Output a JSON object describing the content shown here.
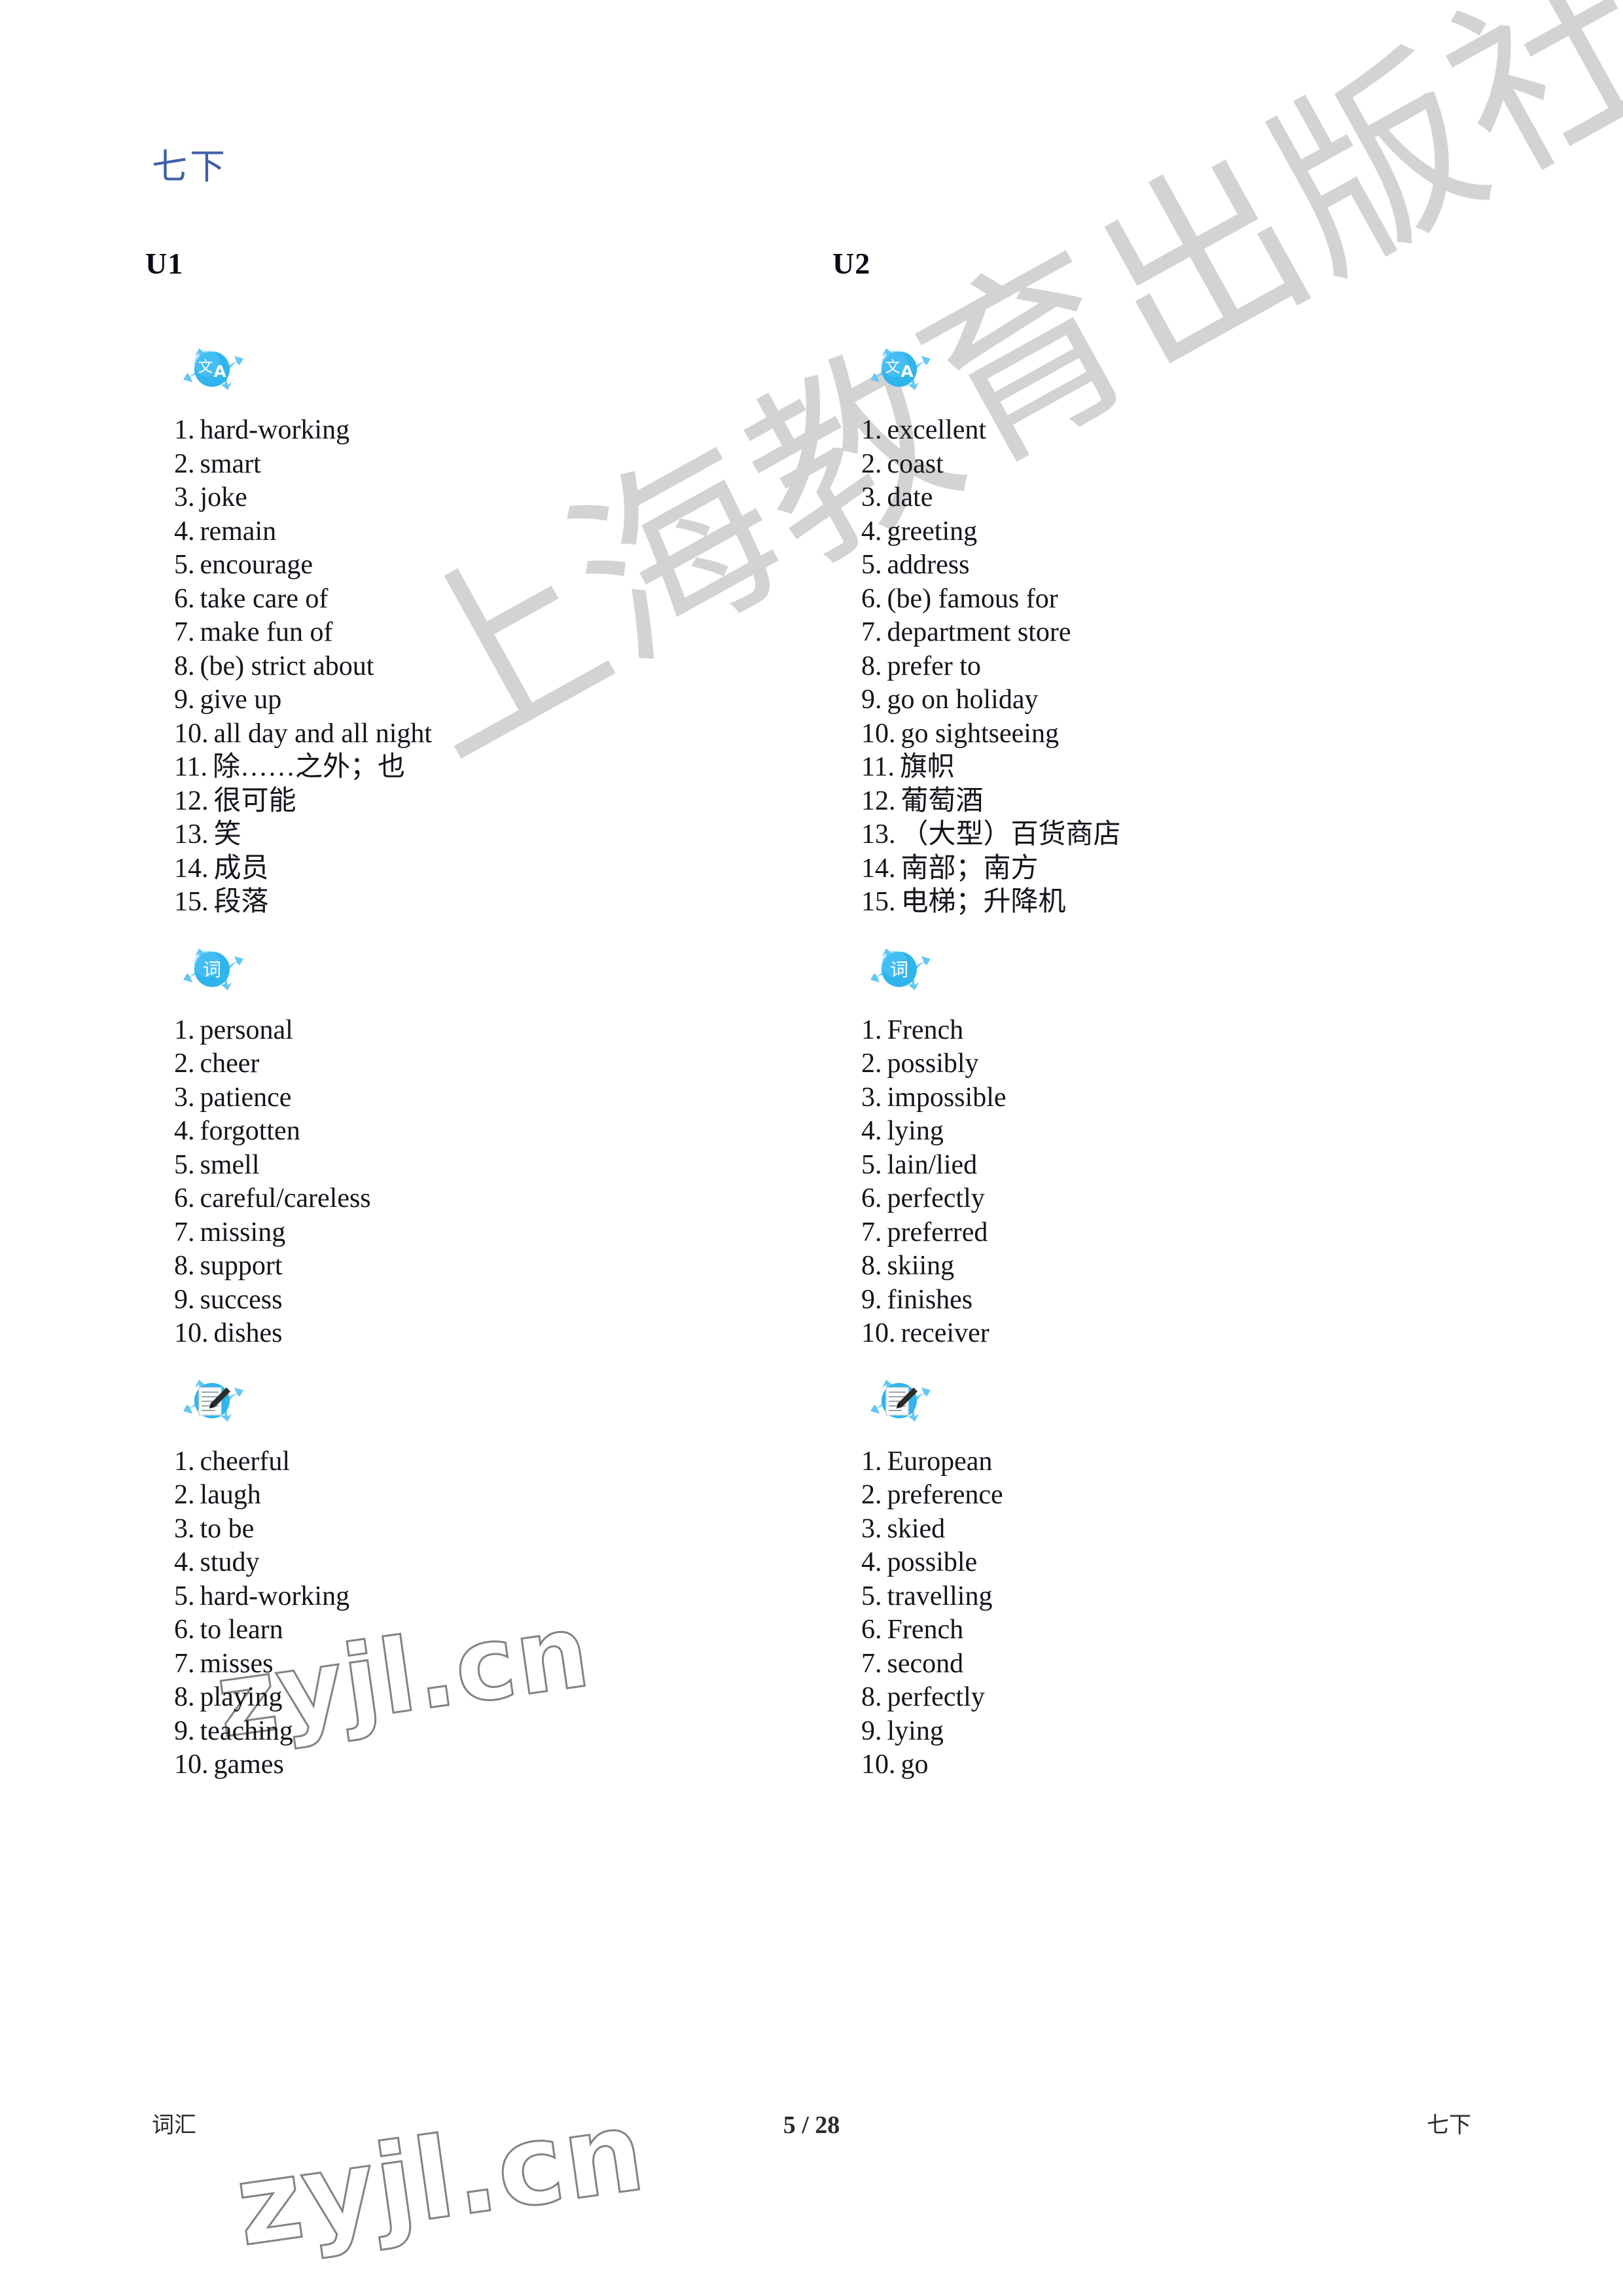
{
  "document": {
    "title": "七下",
    "title_color": "#3f5fa8"
  },
  "watermarks": {
    "publisher": "上海教育出版社",
    "site_middle": "zyjl.cn",
    "site_bottom": "zyjl.cn"
  },
  "columns": [
    {
      "unit": "U1",
      "sections": [
        {
          "icon": "translate-icon",
          "icon_glyphs": {
            "cn": "文",
            "en": "A"
          },
          "items": [
            "hard-working",
            "smart",
            "joke",
            "remain",
            "encourage",
            "take care of",
            "make fun of",
            "(be) strict about",
            "give up",
            "all day and all night",
            "除……之外；也",
            "很可能",
            "笑",
            "成员",
            "段落"
          ]
        },
        {
          "icon": "vocabulary-icon",
          "icon_glyphs": {
            "cn": "词"
          },
          "items": [
            "personal",
            "cheer",
            "patience",
            "forgotten",
            "smell",
            "careful/careless",
            "missing",
            "support",
            "success",
            "dishes"
          ]
        },
        {
          "icon": "notepad-pencil-icon",
          "icon_glyphs": {},
          "items": [
            "cheerful",
            "laugh",
            "to be",
            "study",
            "hard-working",
            "to learn",
            "misses",
            "playing",
            "teaching",
            "games"
          ]
        }
      ]
    },
    {
      "unit": "U2",
      "sections": [
        {
          "icon": "translate-icon",
          "icon_glyphs": {
            "cn": "文",
            "en": "A"
          },
          "items": [
            "excellent",
            "coast",
            "date",
            "greeting",
            "address",
            "(be) famous for",
            "department store",
            "prefer to",
            "go on holiday",
            "go sightseeing",
            "旗帜",
            "葡萄酒",
            "（大型）百货商店",
            "南部；南方",
            "电梯；升降机"
          ]
        },
        {
          "icon": "vocabulary-icon",
          "icon_glyphs": {
            "cn": "词"
          },
          "items": [
            "French",
            "possibly",
            "impossible",
            "lying",
            "lain/lied",
            "perfectly",
            "preferred",
            "skiing",
            "finishes",
            "receiver"
          ]
        },
        {
          "icon": "notepad-pencil-icon",
          "icon_glyphs": {},
          "items": [
            "European",
            "preference",
            "skied",
            "possible",
            "travelling",
            "French",
            "second",
            "perfectly",
            "lying",
            "go"
          ]
        }
      ]
    }
  ],
  "footer": {
    "left": "词汇",
    "center": "5 / 28",
    "right": "七下"
  },
  "colors": {
    "title_blue": "#3f5fa8",
    "icon_blue": "#2fb4ee",
    "icon_blue_dark": "#1b94d6",
    "icon_arrow": "#64c8f2",
    "watermark_grey": "#b9b9b9",
    "text": "#14141c"
  }
}
